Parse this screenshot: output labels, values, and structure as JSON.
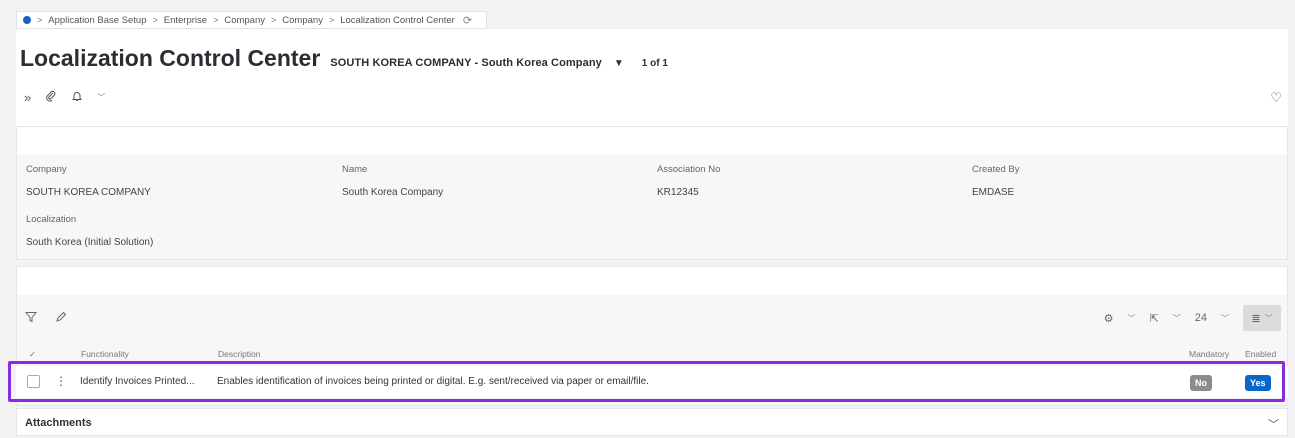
{
  "breadcrumb": {
    "items": [
      "Application Base Setup",
      "Enterprise",
      "Company",
      "Company",
      "Localization Control Center"
    ],
    "separator": ">"
  },
  "header": {
    "title": "Localization Control Center",
    "record": "SOUTH KOREA COMPANY - South Korea Company",
    "count": "1 of 1"
  },
  "details": {
    "company": {
      "label": "Company",
      "value": "SOUTH KOREA COMPANY"
    },
    "name": {
      "label": "Name",
      "value": "South Korea Company"
    },
    "association": {
      "label": "Association No",
      "value": "KR12345"
    },
    "created_by": {
      "label": "Created By",
      "value": "EMDASE"
    },
    "localization": {
      "label": "Localization",
      "value": "South Korea (Initial Solution)"
    }
  },
  "list": {
    "page_size": "24",
    "columns": {
      "functionality": "Functionality",
      "description": "Description",
      "mandatory": "Mandatory",
      "enabled": "Enabled"
    },
    "rows": [
      {
        "functionality": "Identify Invoices Printed...",
        "description": "Enables identification of invoices being printed or digital. E.g. sent/received via paper or email/file.",
        "mandatory": "No",
        "enabled": "Yes"
      }
    ]
  },
  "attachments": {
    "label": "Attachments"
  },
  "colors": {
    "accent": "#0a67c8",
    "highlight": "#8a2be2",
    "badge_no": "#8c8c8c"
  }
}
